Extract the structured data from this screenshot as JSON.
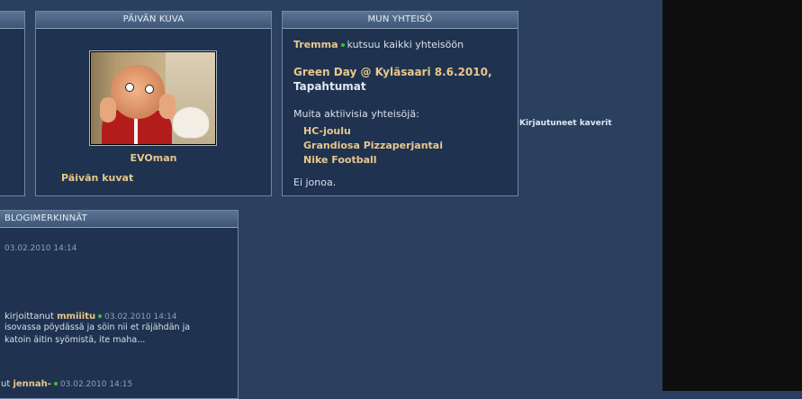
{
  "panels": {
    "kuva": {
      "title": "PÄIVÄN KUVA",
      "photo_caption": "EVOman",
      "link": "Päivän kuvat"
    },
    "yhteiso": {
      "title": "MUN YHTEISÖ",
      "inviter": "Tremma",
      "invite_text": "kutsuu kaikki yhteisöön",
      "event_title": "Green Day @ Kyläsaari 8.6.2010,",
      "event_category": "Tapahtumat",
      "other_label": "Muita aktiivisia yhteisöjä:",
      "communities": [
        "HC-joulu",
        "Grandiosa Pizzaperjantai",
        "Nike Football"
      ],
      "queue_text": "Ei jonoa."
    },
    "blog": {
      "title": "BLOGIMERKINNÄT",
      "entries": [
        {
          "timestamp": "03.02.2010 14:14"
        },
        {
          "prefix": "kirjoittanut",
          "author": "mmiiitu",
          "timestamp": "03.02.2010 14:14",
          "line1": "isovassa pöydässä ja söin nii et räjähdän ja",
          "line2": "katoin äitin syömistä, ite maha..."
        },
        {
          "prefix": "ut",
          "author": "jennah-",
          "timestamp": "03.02.2010 14:15"
        }
      ]
    }
  },
  "sidebar": {
    "friends_label": "Kirjautuneet kaverit"
  },
  "colors": {
    "background": "#2b405e",
    "panel": "#1f3350",
    "accent": "#e8c78c",
    "online": "#3fbf2e"
  }
}
